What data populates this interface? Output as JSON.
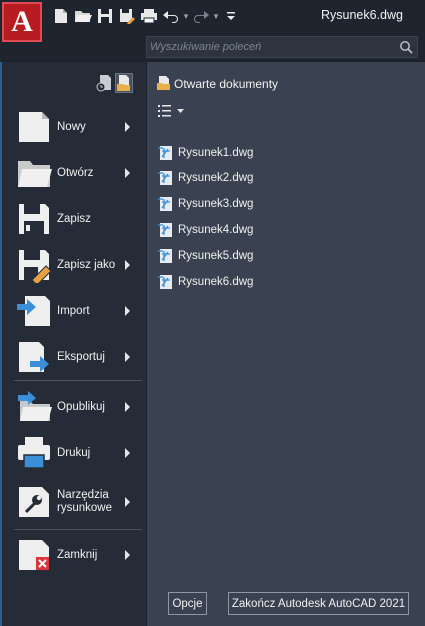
{
  "app": {
    "logo_letter": "A",
    "title": "Rysunek6.dwg"
  },
  "quick_access": [
    {
      "name": "new-icon"
    },
    {
      "name": "open-icon"
    },
    {
      "name": "save-icon"
    },
    {
      "name": "save-as-icon"
    },
    {
      "name": "print-icon"
    },
    {
      "name": "undo-icon"
    },
    {
      "name": "redo-icon"
    },
    {
      "name": "customize-icon"
    }
  ],
  "search": {
    "placeholder": "Wyszukiwanie poleceń"
  },
  "menu": {
    "items": [
      {
        "label": "Nowy",
        "icon": "new-document-icon",
        "has_submenu": true
      },
      {
        "label": "Otwórz",
        "icon": "open-folder-icon",
        "has_submenu": true
      },
      {
        "label": "Zapisz",
        "icon": "save-floppy-icon",
        "has_submenu": false
      },
      {
        "label": "Zapisz jako",
        "icon": "save-as-icon",
        "has_submenu": true
      },
      {
        "label": "Import",
        "icon": "import-icon",
        "has_submenu": true
      },
      {
        "label": "Eksportuj",
        "icon": "export-icon",
        "has_submenu": true
      },
      {
        "label": "Opublikuj",
        "icon": "publish-icon",
        "has_submenu": true
      },
      {
        "label": "Drukuj",
        "icon": "printer-icon",
        "has_submenu": true
      },
      {
        "label": "Narzędzia rysunkowe",
        "icon": "drawing-utilities-icon",
        "has_submenu": true
      },
      {
        "label": "Zamknij",
        "icon": "close-document-icon",
        "has_submenu": true
      }
    ]
  },
  "panel": {
    "title": "Otwarte dokumenty",
    "documents": [
      "Rysunek1.dwg",
      "Rysunek2.dwg",
      "Rysunek3.dwg",
      "Rysunek4.dwg",
      "Rysunek5.dwg",
      "Rysunek6.dwg"
    ]
  },
  "footer": {
    "options_label": "Opcje",
    "exit_label": "Zakończ Autodesk AutoCAD 2021"
  },
  "colors": {
    "accent": "#b81c23",
    "panel": "#3a4251",
    "menu": "#252c37",
    "dwg_icon": "#3b8fd9"
  }
}
